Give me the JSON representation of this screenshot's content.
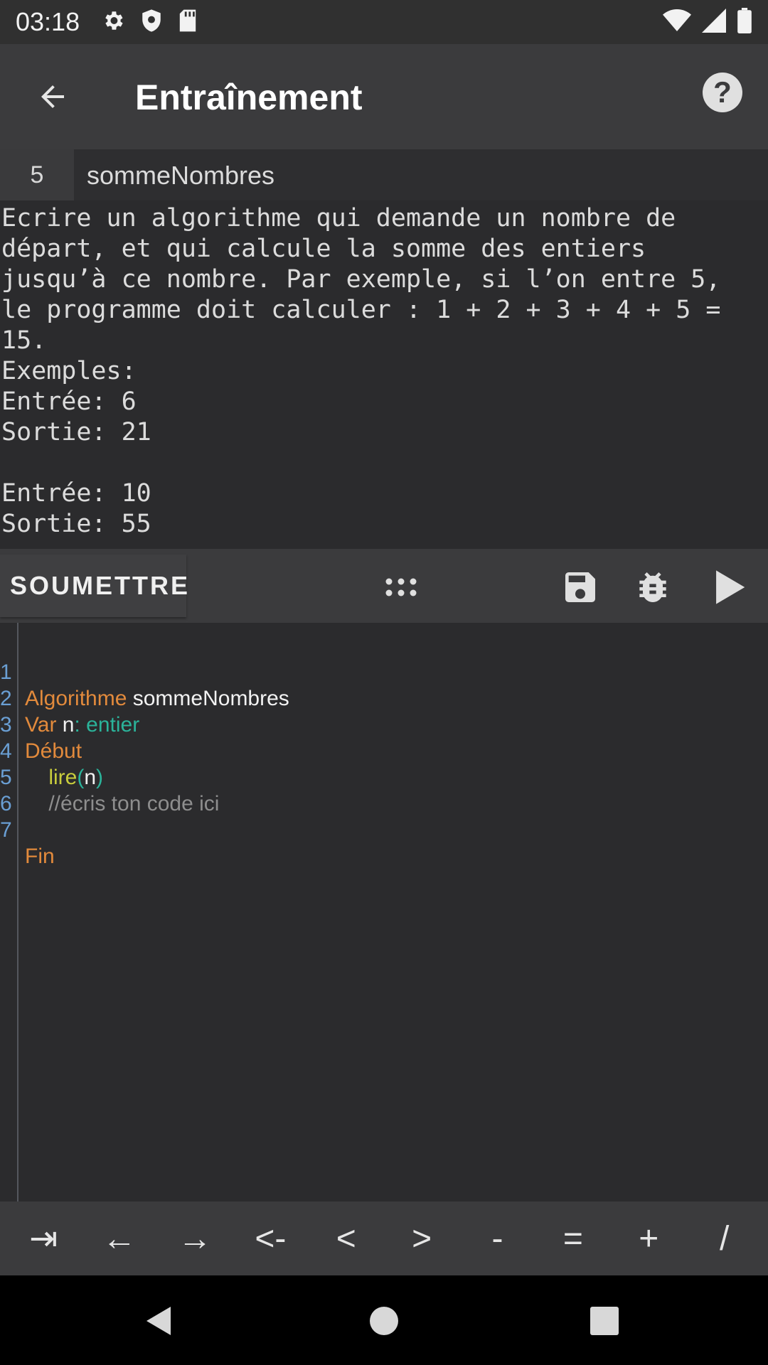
{
  "status_bar": {
    "time": "03:18"
  },
  "app_bar": {
    "title": "Entraînement"
  },
  "problem": {
    "number": "5",
    "name": "sommeNombres",
    "description": "Ecrire un algorithme qui demande un nombre de\ndépart, et qui calcule la somme des entiers\njusqu’à ce nombre. Par exemple, si l’on entre 5,\nle programme doit calculer : 1 + 2 + 3 + 4 + 5 =\n15.\nExemples:\nEntrée: 6\nSortie: 21\n\nEntrée: 10\nSortie: 55"
  },
  "toolbar": {
    "submit_label": "SOUMETTRE"
  },
  "editor": {
    "lines": [
      {
        "n": "1",
        "parts": [
          "Algorithme",
          " sommeNombres"
        ]
      },
      {
        "n": "2",
        "parts": [
          "Var",
          " n",
          ":",
          " entier"
        ]
      },
      {
        "n": "3",
        "parts": [
          "Début"
        ]
      },
      {
        "n": "4",
        "parts": [
          "    lire",
          "(",
          "n",
          ")"
        ]
      },
      {
        "n": "5",
        "parts": [
          "    //écris ton code ici"
        ]
      },
      {
        "n": "6",
        "parts": [
          ""
        ]
      },
      {
        "n": "7",
        "parts": [
          "Fin"
        ]
      }
    ]
  },
  "keys": [
    "⇥",
    "←",
    "→",
    "<-",
    "<",
    ">",
    "-",
    "=",
    "+",
    "/"
  ],
  "colors": {
    "keyword": "#e28a3c",
    "type": "#2bb39a",
    "function": "#c8cc3c",
    "comment": "#8e8e8e",
    "line_number": "#6a9fd4"
  }
}
